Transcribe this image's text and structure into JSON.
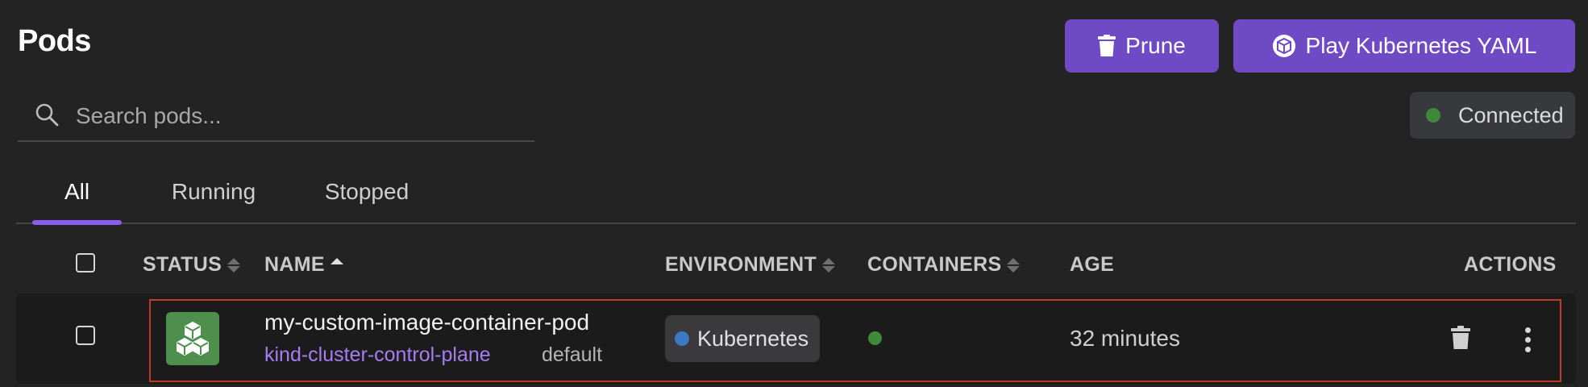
{
  "header": {
    "title": "Pods",
    "prune_label": "Prune",
    "play_label": "Play Kubernetes YAML"
  },
  "search": {
    "placeholder": "Search pods...",
    "value": ""
  },
  "connection": {
    "label": "Connected",
    "color": "#3f8a3a"
  },
  "tabs": [
    {
      "label": "All",
      "active": true
    },
    {
      "label": "Running",
      "active": false
    },
    {
      "label": "Stopped",
      "active": false
    }
  ],
  "table": {
    "columns": {
      "status": "STATUS",
      "name": "NAME",
      "environment": "ENVIRONMENT",
      "containers": "CONTAINERS",
      "age": "AGE",
      "actions": "ACTIONS"
    },
    "rows": [
      {
        "name": "my-custom-image-container-pod",
        "node": "kind-cluster-control-plane",
        "namespace": "default",
        "environment": "Kubernetes",
        "environment_color": "#3b79c4",
        "containers_status_color": "#3f8a3a",
        "age": "32 minutes",
        "status_icon": "pod-cubes-icon"
      }
    ]
  },
  "colors": {
    "accent": "#6e4bc4",
    "tab_underline": "#8a5cf0",
    "link": "#a77cf3",
    "status_green": "#4f8f4e",
    "highlight": "#c0392b"
  }
}
